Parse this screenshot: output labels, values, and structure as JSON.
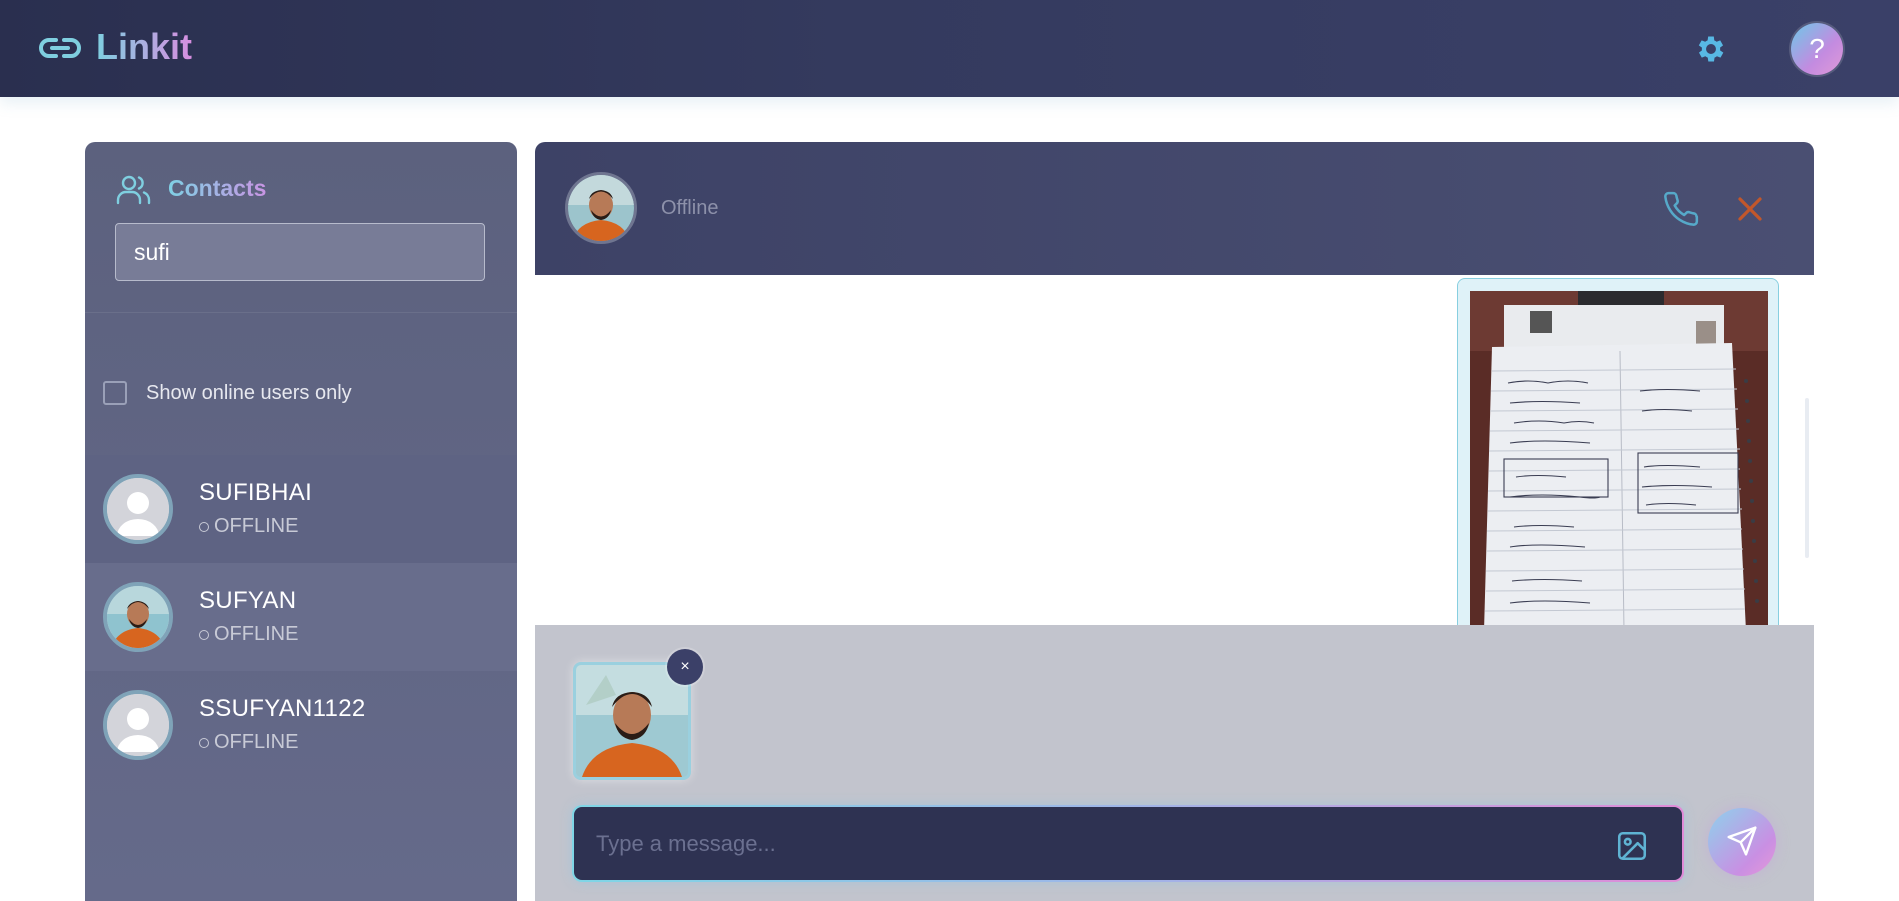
{
  "app": {
    "name": "Linkit",
    "help_label": "?",
    "colors": {
      "accent_cyan": "#7fcfe0",
      "accent_pink": "#d78ee0",
      "topbar": "#2f3454",
      "danger": "#c2572b"
    }
  },
  "sidebar": {
    "title": "Contacts",
    "search": {
      "value": "sufi",
      "placeholder": ""
    },
    "online_filter": {
      "label": "Show online users only",
      "checked": false
    },
    "contacts": [
      {
        "name": "SUFIBHAI",
        "status": "OFFLINE",
        "avatar": "default-avatar"
      },
      {
        "name": "SUFYAN",
        "status": "OFFLINE",
        "avatar": "photo-avatar"
      },
      {
        "name": "SSUFYAN1122",
        "status": "OFFLINE",
        "avatar": "default-avatar"
      }
    ]
  },
  "chat": {
    "header": {
      "status": "Offline",
      "avatar": "photo-avatar"
    },
    "messages": [
      {
        "type": "image",
        "content": "photo of a handwritten notebook page"
      }
    ],
    "composer": {
      "placeholder": "Type a message...",
      "attachment_preview": {
        "remove_label": "×"
      }
    }
  }
}
